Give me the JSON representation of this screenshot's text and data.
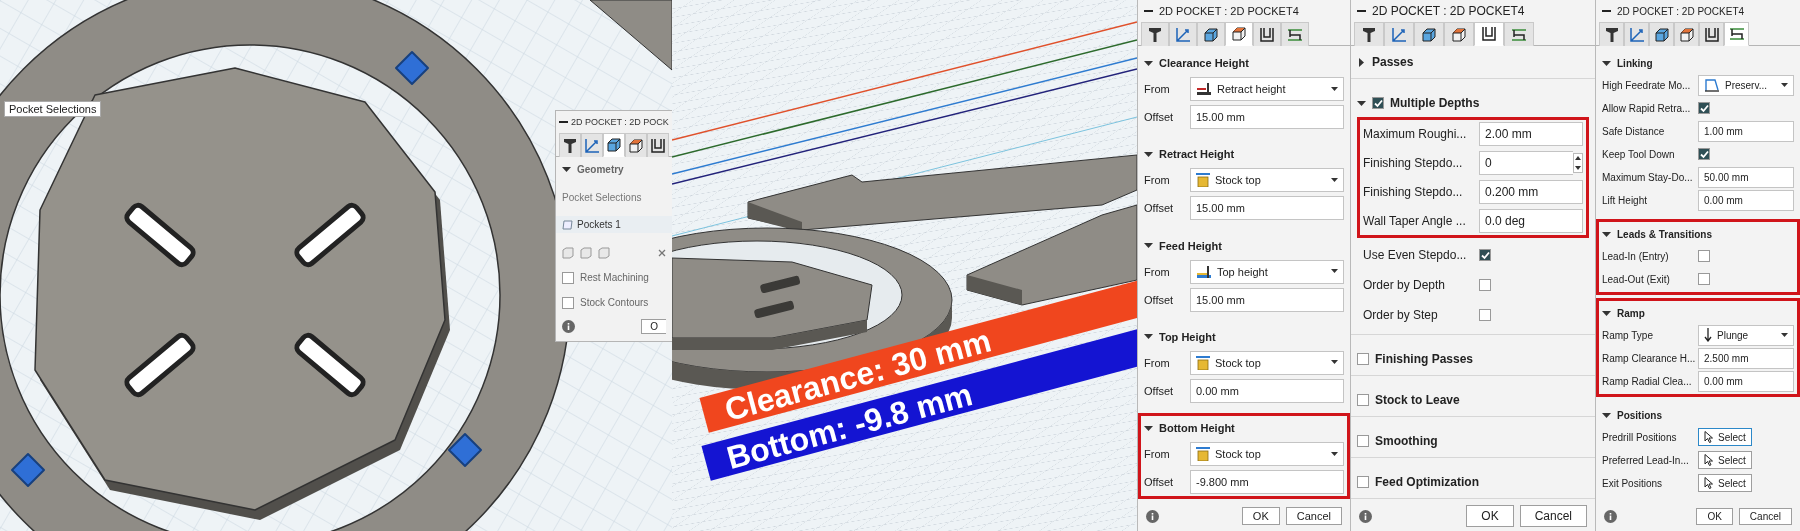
{
  "left_viewport": {
    "tooltip": "Pocket Selections",
    "dialog": {
      "title": "2D POCKET : 2D POCK",
      "tabs": [
        {
          "kind": "tool",
          "selected": false
        },
        {
          "kind": "geometry",
          "selected": false
        },
        {
          "kind": "contour",
          "selected": true
        },
        {
          "kind": "heights",
          "selected": false
        },
        {
          "kind": "passes",
          "selected": false
        }
      ],
      "section": {
        "title": "Geometry",
        "expanded": true
      },
      "selection_label": "Pocket Selections",
      "selection_item": "Pockets 1",
      "options": [
        {
          "label": "Rest Machining",
          "checked": false
        },
        {
          "label": "Stock Contours",
          "checked": false
        }
      ],
      "ok_button": "O"
    }
  },
  "right_viewport": {
    "labels": [
      {
        "text": "Clearance: 30 mm",
        "color": "#f0461e"
      },
      {
        "text": "Bottom: -9.8 mm",
        "color": "#1414d2"
      }
    ]
  },
  "heights_dialog": {
    "title": "2D POCKET : 2D POCKET4",
    "tabs": [
      {
        "kind": "tool",
        "selected": false
      },
      {
        "kind": "geometry",
        "selected": false
      },
      {
        "kind": "contour",
        "selected": false
      },
      {
        "kind": "heights",
        "selected": true
      },
      {
        "kind": "passes",
        "selected": false
      },
      {
        "kind": "linking",
        "selected": false
      }
    ],
    "sections": [
      {
        "title": "Clearance Height",
        "expanded": true,
        "highlighted": false,
        "kind": "retract",
        "from_label": "From",
        "from_value": "Retract height",
        "offset_label": "Offset",
        "offset_value": "15.00 mm"
      },
      {
        "title": "Retract Height",
        "expanded": true,
        "highlighted": false,
        "kind": "stock",
        "from_label": "From",
        "from_value": "Stock top",
        "offset_label": "Offset",
        "offset_value": "15.00 mm"
      },
      {
        "title": "Feed Height",
        "expanded": true,
        "highlighted": false,
        "kind": "top",
        "from_label": "From",
        "from_value": "Top height",
        "offset_label": "Offset",
        "offset_value": "15.00 mm"
      },
      {
        "title": "Top Height",
        "expanded": true,
        "highlighted": false,
        "kind": "stock",
        "from_label": "From",
        "from_value": "Stock top",
        "offset_label": "Offset",
        "offset_value": "0.00 mm"
      },
      {
        "title": "Bottom Height",
        "expanded": true,
        "highlighted": true,
        "kind": "stock",
        "from_label": "From",
        "from_value": "Stock top",
        "offset_label": "Offset",
        "offset_value": "-9.800 mm"
      }
    ],
    "buttons": [
      "OK",
      "Cancel"
    ]
  },
  "passes_dialog": {
    "title": "2D POCKET : 2D POCKET4",
    "tabs": [
      {
        "kind": "tool",
        "selected": false
      },
      {
        "kind": "geometry",
        "selected": false
      },
      {
        "kind": "contour",
        "selected": false
      },
      {
        "kind": "heights",
        "selected": false
      },
      {
        "kind": "passes",
        "selected": true
      },
      {
        "kind": "linking",
        "selected": false
      }
    ],
    "passes": {
      "title": "Passes",
      "expanded": false
    },
    "multiple_depths": {
      "title": "Multiple Depths",
      "checked": true,
      "expanded": true,
      "highlighted": true,
      "fields": [
        {
          "label": "Maximum Roughi...",
          "value": "2.00 mm",
          "kind": "text"
        },
        {
          "label": "Finishing Stepdo...",
          "value": "0",
          "kind": "spinner"
        },
        {
          "label": "Finishing Stepdo...",
          "value": "0.200 mm",
          "kind": "text"
        },
        {
          "label": "Wall Taper Angle ...",
          "value": "0.0 deg",
          "kind": "text"
        }
      ],
      "options": [
        {
          "label": "Use Even Stepdo...",
          "checked": true
        },
        {
          "label": "Order by Depth",
          "checked": false
        },
        {
          "label": "Order by Step",
          "checked": false
        }
      ]
    },
    "sections": [
      {
        "title": "Finishing Passes",
        "checked": false
      },
      {
        "title": "Stock to Leave",
        "checked": false
      },
      {
        "title": "Smoothing",
        "checked": false
      },
      {
        "title": "Feed Optimization",
        "checked": false
      }
    ],
    "buttons": [
      "OK",
      "Cancel"
    ]
  },
  "linking_dialog": {
    "title": "2D POCKET : 2D POCKET4",
    "tabs": [
      {
        "kind": "tool",
        "selected": false
      },
      {
        "kind": "geometry",
        "selected": false
      },
      {
        "kind": "contour",
        "selected": false
      },
      {
        "kind": "heights",
        "selected": false
      },
      {
        "kind": "passes",
        "selected": false
      },
      {
        "kind": "linking",
        "selected": true
      }
    ],
    "sections": [
      {
        "title": "Linking",
        "expanded": true,
        "highlighted": false,
        "rows": [
          {
            "kind": "modeselect",
            "label": "High Feedrate Mo...",
            "value": "Preserv..."
          },
          {
            "kind": "checkbox",
            "label": "Allow Rapid Retra...",
            "checked": true
          },
          {
            "kind": "text",
            "label": "Safe Distance",
            "value": "1.00 mm"
          },
          {
            "kind": "checkbox",
            "label": "Keep Tool Down",
            "checked": true
          },
          {
            "kind": "text",
            "label": "Maximum Stay-Do...",
            "value": "50.00 mm"
          },
          {
            "kind": "text",
            "label": "Lift Height",
            "value": "0.00 mm"
          }
        ]
      },
      {
        "title": "Leads & Transitions",
        "expanded": true,
        "highlighted": true,
        "rows": [
          {
            "kind": "checkbox",
            "label": "Lead-In (Entry)",
            "checked": false
          },
          {
            "kind": "checkbox",
            "label": "Lead-Out (Exit)",
            "checked": false
          }
        ]
      },
      {
        "title": "Ramp",
        "expanded": true,
        "highlighted": true,
        "rows": [
          {
            "kind": "rampselect",
            "label": "Ramp Type",
            "value": "Plunge"
          },
          {
            "kind": "text",
            "label": "Ramp Clearance H...",
            "value": "2.500 mm"
          },
          {
            "kind": "text",
            "label": "Ramp Radial Clea...",
            "value": "0.00 mm"
          }
        ]
      },
      {
        "title": "Positions",
        "expanded": true,
        "highlighted": false,
        "rows": [
          {
            "kind": "button",
            "label": "Predrill Positions",
            "value": "Select",
            "selected": true
          },
          {
            "kind": "button",
            "label": "Preferred Lead-In...",
            "value": "Select",
            "selected": false
          },
          {
            "kind": "button",
            "label": "Exit Positions",
            "value": "Select",
            "selected": false
          }
        ]
      }
    ],
    "buttons": [
      "OK",
      "Cancel"
    ]
  }
}
